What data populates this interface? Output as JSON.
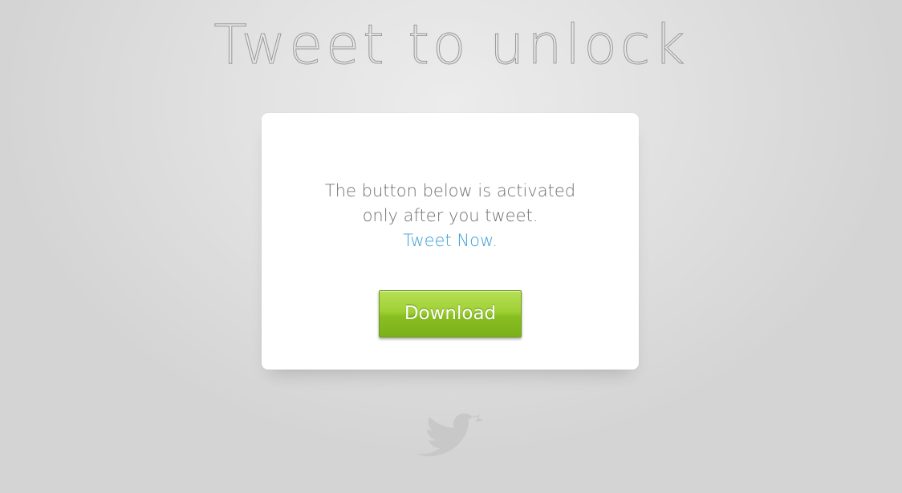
{
  "page": {
    "title": "Tweet to unlock"
  },
  "card": {
    "message_line1": "The button below is activated",
    "message_line2": "only after you tweet.",
    "tweet_link": "Tweet Now.",
    "download_label": "Download"
  },
  "colors": {
    "link": "#3d9fd8",
    "button_green": "#8abf22",
    "background": "#dcdcdc"
  },
  "icons": {
    "footer": "twitter-bird-icon"
  }
}
